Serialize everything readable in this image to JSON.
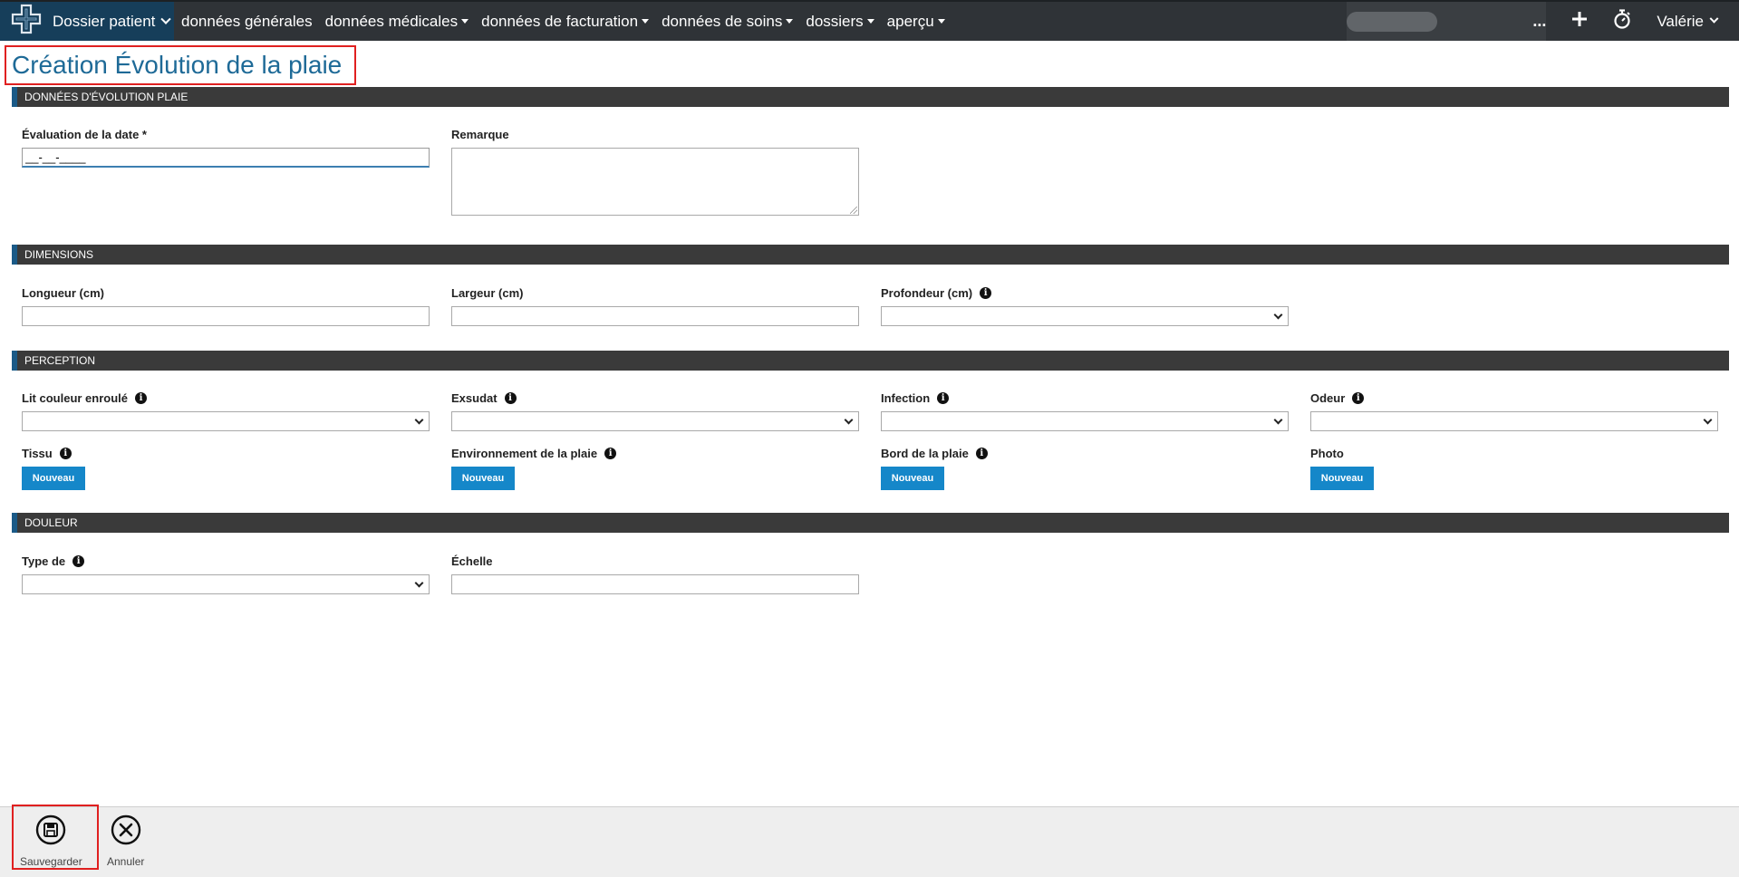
{
  "nav": {
    "brand": "Dossier patient",
    "items": [
      {
        "label": "données générales",
        "dropdown": false
      },
      {
        "label": "données médicales",
        "dropdown": true
      },
      {
        "label": "données de facturation",
        "dropdown": true
      },
      {
        "label": "données de soins",
        "dropdown": true
      },
      {
        "label": "dossiers",
        "dropdown": true
      },
      {
        "label": "aperçu",
        "dropdown": true
      }
    ],
    "more": "...",
    "add": "+",
    "user": "Valérie",
    "icons": [
      "plus-cross-logo-icon",
      "plus-icon",
      "stopwatch-icon"
    ]
  },
  "page": {
    "title": "Création Évolution de la plaie"
  },
  "sections": {
    "evolution": {
      "title": "DONNÉES D'ÉVOLUTION PLAIE",
      "date_label": "Évaluation de la date *",
      "date_value": "__-__-____",
      "remark_label": "Remarque"
    },
    "dimensions": {
      "title": "DIMENSIONS",
      "length_label": "Longueur (cm)",
      "width_label": "Largeur (cm)",
      "depth_label": "Profondeur (cm)"
    },
    "perception": {
      "title": "PERCEPTION",
      "bed_color_label": "Lit couleur enroulé",
      "exudate_label": "Exsudat",
      "infection_label": "Infection",
      "odor_label": "Odeur",
      "tissue_label": "Tissu",
      "environment_label": "Environnement de la plaie",
      "edge_label": "Bord de la plaie",
      "photo_label": "Photo",
      "new_button": "Nouveau"
    },
    "pain": {
      "title": "DOULEUR",
      "type_label": "Type de",
      "scale_label": "Échelle"
    }
  },
  "footer": {
    "save": "Sauvegarder",
    "cancel": "Annuler"
  },
  "colors": {
    "topbar": "#2f3337",
    "brand": "#163e5a",
    "title": "#1e6a97",
    "section_bar": "#3a3a3a",
    "section_accent": "#1b5a87",
    "button": "#1587c9",
    "highlight": "#e02020"
  }
}
